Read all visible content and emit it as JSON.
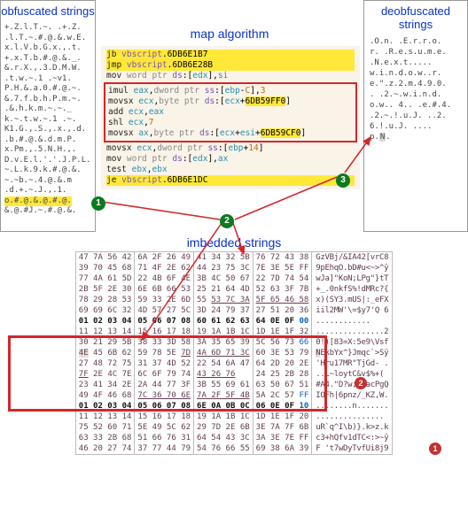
{
  "headers": {
    "obf": "obfuscated strings",
    "deobf": "deobfuscated strings",
    "map": "map algorithm",
    "embedded": "imbedded strings"
  },
  "obf_lines": [
    "+.Z.l.T.~. .+.Z.",
    ".l.T.~.#.@.&.w.E.",
    "x.l.V.b.G.x.,.t.",
    "+.x.T.b.#.@.&._.",
    "&.r.X.,.3.D.M.W.",
    ".t.w.~.1 .~v1.",
    "P.H.&.a.0.#.@.~.",
    "&.7.f.b.h.P.m.~.",
    ".&.h.k.m.~.~._",
    "k.~.t.w.~.1 .~.",
    "K1.G.,.S.,.x.,.d.",
    ".b.#.@.&.d.m.P.",
    "x.Pm.,.5.N.H.,.",
    "D.v.E.l.'.'.J.P.L.",
    "~.L.k.9.k.#.@.&.",
    "~.~b.~.4.@.&.m",
    ".d.+.~.J.,.1.",
    "o.#.@.&.@.#.@.",
    "&.@.#J.~.#.@.&."
  ],
  "obf_hl_index": 17,
  "deobf_lines": [
    ".O.n. .E.r.r.o.",
    "r. .R.e.s.u.m.e.",
    " .N.e.x.t.....",
    "w.i.n.d.o.w..r.",
    "e.\".z.2.m.4.9.0.",
    ". .2.~.w.i.n.d.",
    "o.w.. 4.. .e.#.4.",
    ".2.~.!.u.J. ..2.",
    "6.!.u.J. ....",
    "p.N."
  ],
  "deobf_hl_index": 9,
  "asm": [
    {
      "hl": true,
      "html": "<span class='asm-op'>jb </span><span class='asm-ds'>vbscript</span>.6DB6E1B7"
    },
    {
      "hl": true,
      "html": "<span class='asm-op'>jmp </span><span class='asm-ds'>vbscript</span>.<span>6DB6E28B</span>"
    },
    {
      "hl": false,
      "html": "<span class='asm-op'>mov </span><span class='asm-ptr'>word ptr </span><span class='asm-ds'>ds</span>:[<span class='asm-reg'>edx</span>],<span class='asm-reg'>si</span>"
    }
  ],
  "asm_boxed": [
    {
      "html": "<span class='asm-op'>imul </span><span class='asm-reg'>eax</span>,<span class='asm-ptr'>dword ptr </span><span class='asm-ds'>ss</span>:[<span class='asm-reg'>ebp</span>-<span class='asm-lit'>C</span>],<span class='asm-lit'>3</span>"
    },
    {
      "html": "<span class='asm-op'>movsx </span><span class='asm-reg'>ecx</span>,<span class='asm-ptr'>byte ptr </span><span class='asm-ds'>ds</span>:[<span class='asm-reg'>ecx</span>+<span class='asm-hlseg'>6DB59FF0</span>]"
    },
    {
      "html": "<span class='asm-op'>add </span><span class='asm-reg'>ecx</span>,<span class='asm-reg'>eax</span>"
    },
    {
      "html": "<span class='asm-op'>shl </span><span class='asm-reg'>ecx</span>,<span class='asm-lit'>7</span>"
    },
    {
      "html": "<span class='asm-op'>movsx </span><span class='asm-reg'>ax</span>,<span class='asm-ptr'>byte ptr </span><span class='asm-ds'>ds</span>:[<span class='asm-reg'>ecx</span>+<span class='asm-reg'>esi</span>+<span class='asm-hlseg'>6DB59CF0</span>]"
    }
  ],
  "asm_after": [
    {
      "hl": false,
      "html": "<span class='asm-op'>movsx </span><span class='asm-reg'>ecx</span>,<span class='asm-ptr'>dword ptr </span><span class='asm-ds'>ss</span>:[<span class='asm-reg'>ebp</span>+<span class='asm-lit'>14</span>]"
    },
    {
      "hl": false,
      "html": "<span class='asm-op'>mov </span><span class='asm-ptr'>word ptr </span><span class='asm-ds'>ds</span>:[<span class='asm-reg'>edx</span>],<span class='asm-reg'>ax</span>"
    },
    {
      "hl": false,
      "html": "<span class='asm-op'>test </span><span class='asm-reg'>ebx</span>,<span class='asm-reg'>ebx</span>"
    },
    {
      "hl": true,
      "html": "<span class='asm-op'>je </span><span class='asm-ds'>vbscript</span>.6DB6E1DC"
    }
  ],
  "hex_rows": [
    {
      "c": [
        "47 7A 56 42",
        "6A 2F 26 49",
        "41 34 32 5B",
        "76 72 43 38"
      ],
      "a": "GzVBj/&IA42[vrC8",
      "top": false
    },
    {
      "c": [
        "39 70 45 68",
        "71 4F 2E 62",
        "44 23 75 3C",
        "7E 3E 5E FF"
      ],
      "a": "9pEhqO.bD#u<~>^ÿ",
      "top": false
    },
    {
      "c": [
        "77 4A 61 5D",
        "22 4B 6F 4E",
        "3B 4C 50 67",
        "22 7D 74 54"
      ],
      "a": "wJa]\"KoN;LPg\"}tT",
      "top": false
    },
    {
      "c": [
        "2B 5F 2E 30",
        "6E 6B 66 53",
        "25 21 64 4D",
        "52 63 3F 7B"
      ],
      "a": "+_.0nkfS%!dMRc?{",
      "top": false
    },
    {
      "c": [
        "78 29 28 53",
        "59 33 2E 6D",
        "55 <span class='underline'>53 7C 3A</span>",
        "<span class='underline'>5F 65 46 58</span>"
      ],
      "a": "x)(SY3.mUS|:_eFX",
      "top": false
    },
    {
      "c": [
        "69 69 6C 32",
        "4D 57 27 5C",
        "3D 24 79 37",
        "27 51 20 36"
      ],
      "a": "iil2MW'\\=$y7'Q 6",
      "top": false
    },
    {
      "c": [
        "<span class='c-dark'>01 02 03 04</span>",
        "<span class='c-dark'>05 06 07 08</span>",
        "<span class='c-dark'>60 61 62 63</span>",
        "<span class='c-dark'>64 0E 0F <span class='c-blue'>00</span></span>"
      ],
      "a": "............",
      "top": false
    },
    {
      "c": [
        "11 12 13 14",
        "15 16 17 18",
        "19 1A 1B 1C",
        "1D 1E 1F 32"
      ],
      "a": "...............2",
      "top": true
    },
    {
      "c": [
        "30 21 29 5B",
        "38 33 3D 58",
        "3A 35 65 39",
        "5C 56 73 <span class='c-blue'>66</span>"
      ],
      "a": "0!)[83=X:5e9\\Vsf",
      "box": true
    },
    {
      "c": [
        "<span class='hex-hl'>4E</span> 45 6B 62",
        "59 78 5E <span class='underline'>7D</span>",
        "<span class='underline'>4A 6D 71 3C</span>",
        "60 3E 53 79"
      ],
      "a": "<span class='hex-hl'>N</span>EkbYx^}Jmqc`>Sÿ",
      "box": true
    },
    {
      "c": [
        "27 48 72 75",
        "31 37 4D 52",
        "22 54 6A 47",
        "64 2D 20 2E"
      ],
      "a": "'Hru17MR\"TjGd- .",
      "box": true
    },
    {
      "c": [
        "<u>7F</u> 2E 4C 7E",
        "6C 6F 79 74",
        "<u>43 26 76</u>",
        "24 25 2B 28"
      ],
      "a": "..L~loytC&v$%+(",
      "box": true
    },
    {
      "c": [
        "23 41 34 2E",
        "2A 44 77 3F",
        "3B 55 69 61",
        "63 50 67 51"
      ],
      "a": "#A4.\"D?w;UiacPgQ",
      "box": true
    },
    {
      "c": [
        "49 4F 46 68",
        "<span class='underline'>7C 36 70 6E</span>",
        "<span class='underline'>7A 2F 5F 4B</span>",
        "5A 2C 57 <span class='c-blue'>FF</span>"
      ],
      "a": "IOFh|6pnz/_KZ,W.",
      "box": true
    },
    {
      "c": [
        "<span class='c-dark'>01 02 03 04</span>",
        "<span class='c-dark'>05 06 07 08</span>",
        "<span class='c-dark'>6E 0A 0B 0C</span>",
        "<span class='c-dark'>06 0E 0F <span class='c-blue'>10</span></span>"
      ],
      "a": "........n.......",
      "bot": true
    },
    {
      "c": [
        "11 12 13 14",
        "15 16 17 18",
        "19 1A 1B 1C",
        "1D 1E 1F 20"
      ],
      "a": "............... "
    },
    {
      "c": [
        "75 52 60 71",
        "5E 49 5C 62",
        "29 7D 2E 6B",
        "3E 7A 7F 6B"
      ],
      "a": "uR`q^I\\b)}.k>z.k"
    },
    {
      "c": [
        "63 33 2B 68",
        "51 66 76 31",
        "64 54 43 3C",
        "3A 3E 7E FF"
      ],
      "a": "c3+hQfv1dTC<:>~ÿ"
    },
    {
      "c": [
        "46 20 27 74",
        "37 77 44 79",
        "54 76 66 55",
        "69 38 6A 39"
      ],
      "a": "F 't7wDyTvfUi8j9"
    }
  ],
  "hex_redbox": {
    "row_start": 8,
    "row_end": 14
  }
}
